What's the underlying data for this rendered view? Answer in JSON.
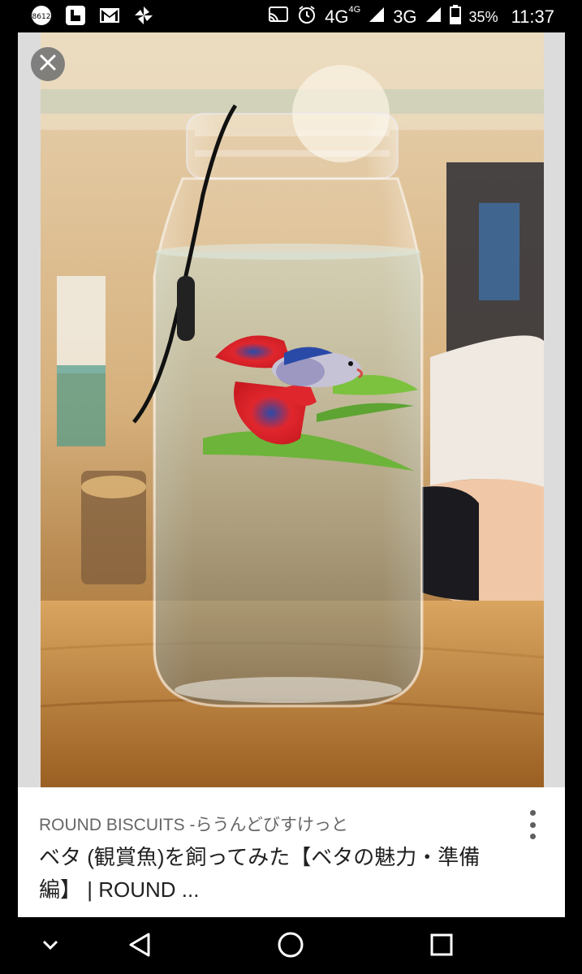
{
  "status_bar": {
    "network": "4G",
    "network_sup": "4G",
    "network2": "3G",
    "battery": "35%",
    "time": "11:37"
  },
  "card": {
    "source": "ROUND BISCUITS -らうんどびすけっと",
    "title": "ベタ (観賞魚)を飼ってみた【ベタの魅力・準備編】 | ROUND ..."
  },
  "colors": {
    "card_bg": "#dcdcdc",
    "caption_bg": "#ffffff",
    "source_text": "#666666",
    "title_text": "#212121",
    "fish_red": "#e0262d",
    "fish_blue": "#2a4aa8",
    "table_wood": "#c48a44"
  },
  "icons": [
    "status-app-icon",
    "photo-icon",
    "gmail-icon",
    "pinwheel-icon",
    "cast-icon",
    "alarm-icon",
    "signal-icon",
    "battery-icon",
    "close-icon",
    "more-vert-icon",
    "chevron-down-icon",
    "back-icon",
    "home-icon",
    "recents-icon"
  ]
}
